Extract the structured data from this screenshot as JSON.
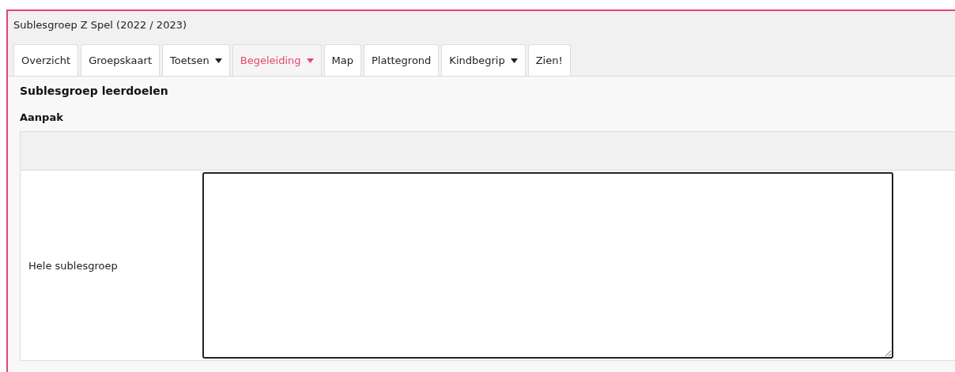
{
  "window": {
    "title": "Sublesgroep Z Spel (2022 / 2023)"
  },
  "tabs": [
    {
      "label": "Overzicht",
      "selected": false,
      "dropdown": false
    },
    {
      "label": "Groepskaart",
      "selected": false,
      "dropdown": false
    },
    {
      "label": "Toetsen",
      "selected": false,
      "dropdown": true
    },
    {
      "label": "Begeleiding",
      "selected": true,
      "dropdown": true
    },
    {
      "label": "Map",
      "selected": false,
      "dropdown": false
    },
    {
      "label": "Plattegrond",
      "selected": false,
      "dropdown": false
    },
    {
      "label": "Kindbegrip",
      "selected": false,
      "dropdown": true
    },
    {
      "label": "Zien!",
      "selected": false,
      "dropdown": false
    }
  ],
  "heading": "Sublesgroep leerdoelen",
  "section": "Aanpak",
  "rows": [
    {
      "label": "Hele sublesgroep",
      "focused": true
    }
  ]
}
